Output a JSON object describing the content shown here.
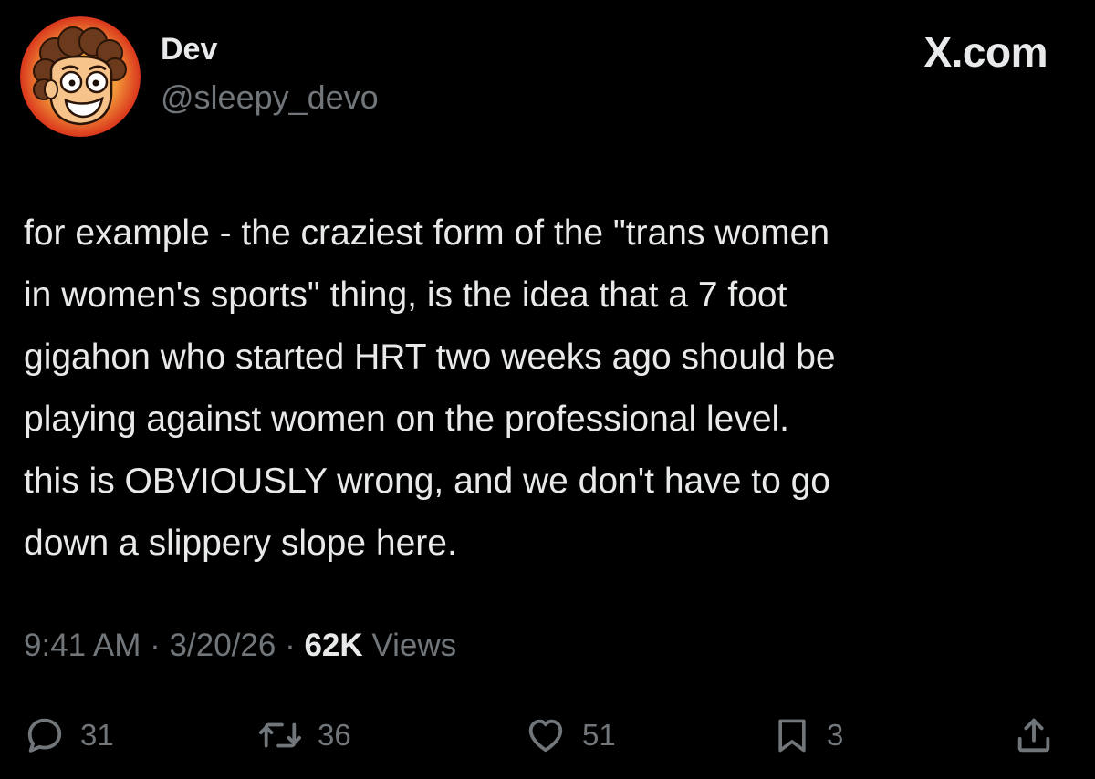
{
  "post": {
    "author": {
      "name": "Dev",
      "handle": "@sleepy_devo",
      "avatar_icon": "cartoon-face-avatar"
    },
    "site_badge": "X.com",
    "text": "for example - the craziest form of the \"trans women\nin women's sports\" thing, is the idea that a 7 foot\ngigahon who started HRT two weeks ago should be\nplaying against women on the professional level.\nthis is OBVIOUSLY wrong, and we don't have to go\ndown a slippery slope here.",
    "meta": {
      "time": "9:41 AM",
      "date": "3/20/26",
      "separator": "·",
      "views_count": "62K",
      "views_label": "Views"
    },
    "actions": {
      "reply": {
        "icon": "reply-icon",
        "count": "31"
      },
      "repost": {
        "icon": "repost-icon",
        "count": "36"
      },
      "like": {
        "icon": "heart-icon",
        "count": "51"
      },
      "bookmark": {
        "icon": "bookmark-icon",
        "count": "3"
      },
      "share": {
        "icon": "share-icon"
      }
    }
  },
  "colors": {
    "background": "#000000",
    "primary_text": "#e7e9ea",
    "secondary_text": "#71767b",
    "avatar_ring": "#e8542c",
    "avatar_face": "#f6c38a",
    "avatar_hair": "#6b3a1c"
  }
}
